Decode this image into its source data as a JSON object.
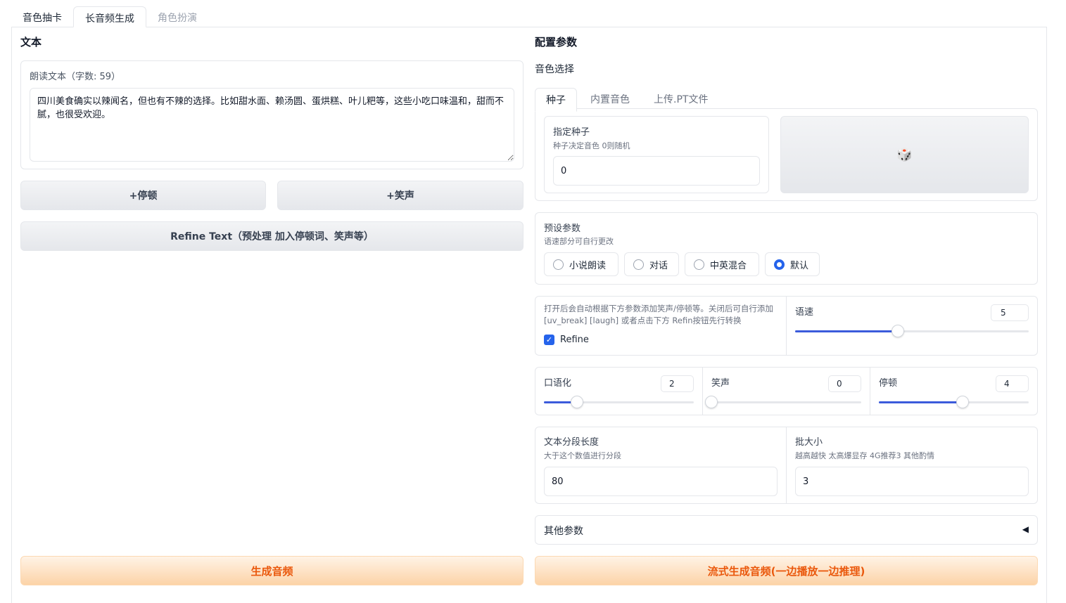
{
  "tabs": [
    "音色抽卡",
    "长音频生成",
    "角色扮演"
  ],
  "left": {
    "section_title": "文本",
    "textbox_label": "朗读文本（字数: 59）",
    "text_value": "四川美食确实以辣闻名，但也有不辣的选择。比如甜水面、赖汤圆、蛋烘糕、叶儿粑等，这些小吃口味温和，甜而不腻，也很受欢迎。",
    "pause_btn": "+停顿",
    "laugh_btn": "+笑声",
    "refine_btn": "Refine Text（预处理 加入停顿词、笑声等）",
    "generate_btn": "生成音频"
  },
  "right": {
    "section_title": "配置参数",
    "voice_label": "音色选择",
    "voice_tabs": [
      "种子",
      "内置音色",
      "上传.PT文件"
    ],
    "seed": {
      "label": "指定种子",
      "hint": "种子决定音色 0则随机",
      "value": "0",
      "dice": "🎲"
    },
    "preset": {
      "label": "预设参数",
      "hint": "语速部分可自行更改",
      "options": [
        "小说朗读",
        "对话",
        "中英混合",
        "默认"
      ],
      "selected": "默认"
    },
    "refine": {
      "hint": "打开后会自动根据下方参数添加笑声/停顿等。关闭后可自行添加 [uv_break] [laugh] 或者点击下方 Refin按钮先行转换",
      "checkbox_label": "Refine",
      "checked": true
    },
    "speed": {
      "label": "语速",
      "value": "5",
      "fraction": 0.44
    },
    "oral": {
      "label": "口语化",
      "value": "2",
      "fraction": 0.22
    },
    "laugh": {
      "label": "笑声",
      "value": "0",
      "fraction": 0.0
    },
    "pause": {
      "label": "停顿",
      "value": "4",
      "fraction": 0.56
    },
    "segment": {
      "label": "文本分段长度",
      "hint": "大于这个数值进行分段",
      "value": "80"
    },
    "batch": {
      "label": "批大小",
      "hint": "越高越快 太高爆显存 4G推荐3 其他酌情",
      "value": "3"
    },
    "other_params": {
      "label": "其他参数",
      "arrow": "◀"
    },
    "stream_btn": "流式生成音频(一边播放一边推理)"
  }
}
